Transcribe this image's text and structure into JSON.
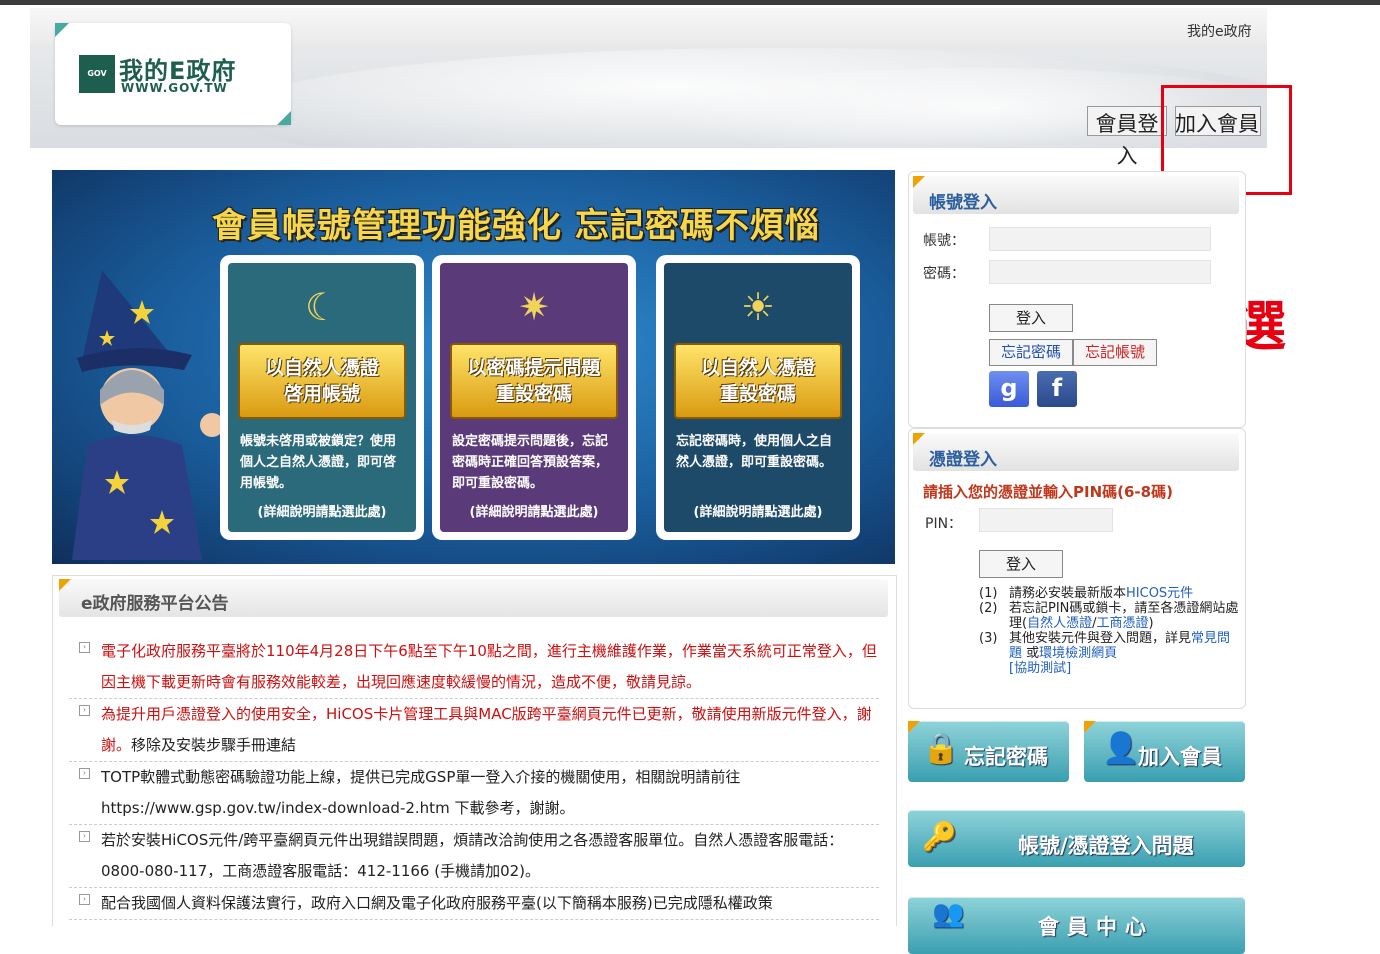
{
  "header": {
    "logo_text": "我的E政府",
    "logo_url": "WWW.GOV.TW",
    "logo_mark": "GOV",
    "my_egov_link": "我的e政府",
    "login_button": "會員登入",
    "join_button": "加入會員"
  },
  "annotation": {
    "click_label": "點選",
    "color": "#e60012"
  },
  "banner": {
    "title": "會員帳號管理功能強化 忘記密碼不煩惱",
    "cards": [
      {
        "line1": "以自然人憑證",
        "line2": "啓用帳號",
        "desc": "帳號未啓用或被鎖定？使用個人之自然人憑證，即可啓用帳號。",
        "more": "(詳細說明請點選此處)",
        "color": "#2a6a7a"
      },
      {
        "line1": "以密碼提示問題",
        "line2": "重設密碼",
        "desc": "設定密碼提示問題後，忘記密碼時正確回答預設答案，即可重設密碼。",
        "more": "(詳細說明請點選此處)",
        "color": "#5b3a7a"
      },
      {
        "line1": "以自然人憑證",
        "line2": "重設密碼",
        "desc": "忘記密碼時，使用個人之自然人憑證，即可重設密碼。",
        "more": "(詳細說明請點選此處)",
        "color": "#1e4a6a"
      }
    ]
  },
  "announcements": {
    "title": "e政府服務平台公告",
    "items": [
      {
        "text": "電子化政府服務平臺將於110年4月28日下午6點至下午10點之間，進行主機維護作業，作業當天系統可正常登入，但因主機下載更新時會有服務效能較差，出現回應速度較緩慢的情況，造成不便，敬請見諒。",
        "style": "red"
      },
      {
        "text": "為提升用戶憑證登入的使用安全，HiCOS卡片管理工具與MAC版跨平臺網頁元件已更新，敬請使用新版元件登入，謝謝。",
        "extra": "移除及安裝步驟手冊連結",
        "style": "red"
      },
      {
        "text": "TOTP軟體式動態密碼驗證功能上線，提供已完成GSP單一登入介接的機關使用，相關說明請前往https://www.gsp.gov.tw/index-download-2.htm 下載參考，謝謝。",
        "style": "black"
      },
      {
        "text": "若於安裝HiCOS元件/跨平臺網頁元件出現錯誤問題，煩請改洽詢使用之各憑證客服單位。自然人憑證客服電話：0800-080-117，工商憑證客服電話：412-1166 (手機請加02)。",
        "style": "black"
      },
      {
        "text": "配合我國個人資料保護法實行，政府入口網及電子化政府服務平臺(以下簡稱本服務)已完成隱私權政策",
        "style": "black"
      }
    ]
  },
  "account_login": {
    "title": "帳號登入",
    "account_label": "帳號：",
    "password_label": "密碼：",
    "login_button": "登入",
    "forgot_password": "忘記密碼",
    "forgot_account": "忘記帳號",
    "google": "g",
    "facebook": "f"
  },
  "cert_login": {
    "title": "憑證登入",
    "pin_note": "請插入您的憑證並輸入PIN碼(6-8碼)",
    "pin_label": "PIN：",
    "login_button": "登入",
    "note1_no": "(1)",
    "note1_a": "請務必安裝最新版本",
    "note1_link": "HICOS元件",
    "note2_no": "(2)",
    "note2_a": "若忘記PIN碼或鎖卡，請至各憑證網站處理(",
    "note2_link1": "自然人憑證",
    "note2_sep": "/",
    "note2_link2": "工商憑證",
    "note2_b": ")",
    "note3_no": "(3)",
    "note3_a": "其他安裝元件與登入問題，詳見",
    "note3_link1": "常見問題",
    "note3_mid": "或",
    "note3_link2": "環境檢測網頁",
    "note3_link3": "[協助測試]"
  },
  "quick_buttons": {
    "forgot_password": "忘記密碼",
    "join_member": "加入會員",
    "login_issue": "帳號/憑證登入問題",
    "member_center": "會員中心"
  }
}
